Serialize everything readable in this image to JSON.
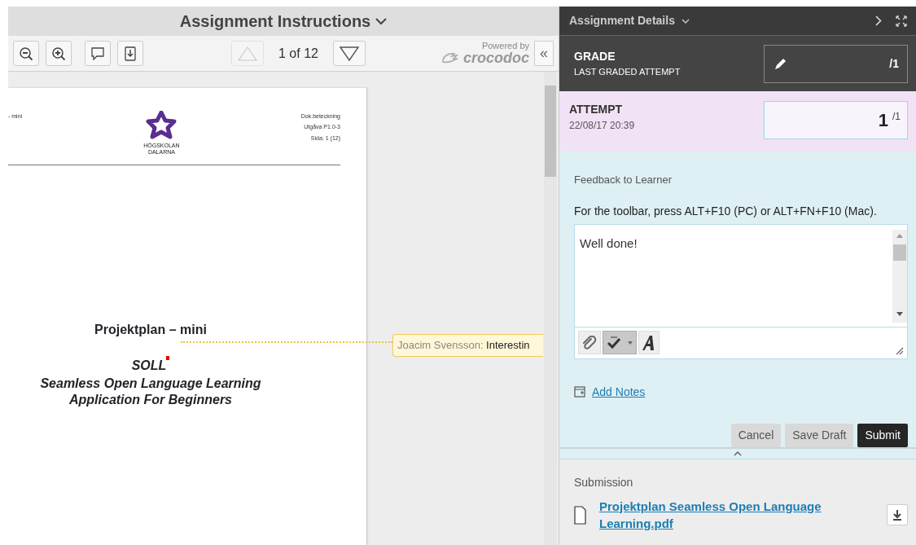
{
  "instructions": {
    "title": "Assignment Instructions",
    "toolbar": {
      "tools": [
        {
          "kind": "zoom-out"
        },
        {
          "kind": "zoom-in"
        },
        {
          "kind": "comment"
        },
        {
          "kind": "download"
        }
      ],
      "prev_disabled": true,
      "next_disabled": false,
      "page_indicator": "1 of 12",
      "powered_by": "Powered by",
      "brand": "crocodoc",
      "collapse": "«"
    },
    "document": {
      "header_left": "- mini",
      "logo_lines": [
        "HÖGSKOLAN",
        "DALARNA"
      ],
      "header_right": [
        "Dok.beteckning",
        "Utgåva P1.0-3",
        "Sida: 1 (12)"
      ],
      "title": "Projektplan – mini",
      "acronym": "SOLL",
      "subtitle_lines": [
        "Seamless Open Language Learning",
        "Application For Beginners"
      ]
    },
    "annotation": {
      "author": "Joacim Svensson:",
      "text": "Interestin"
    }
  },
  "details": {
    "title": "Assignment Details",
    "grade": {
      "label": "GRADE",
      "sublabel": "LAST GRADED ATTEMPT",
      "out_of": "/1"
    },
    "attempt": {
      "label": "ATTEMPT",
      "date": "22/08/17 20:39",
      "value": "1",
      "out_of": "/1"
    },
    "feedback": {
      "label": "Feedback to Learner",
      "hint": "For the toolbar, press ALT+F10 (PC) or ALT+FN+F10 (Mac).",
      "value": "Well done!",
      "tools": [
        {
          "kind": "attach",
          "selected": false
        },
        {
          "kind": "spellcheck",
          "selected": true
        },
        {
          "kind": "font",
          "selected": false
        }
      ]
    },
    "add_notes": "Add Notes",
    "buttons": [
      {
        "label": "Cancel",
        "kind": "secondary"
      },
      {
        "label": "Save Draft",
        "kind": "secondary"
      },
      {
        "label": "Submit",
        "kind": "primary"
      }
    ],
    "submission": {
      "label": "Submission",
      "file": "Projektplan Seamless Open Language Learning.pdf"
    }
  }
}
